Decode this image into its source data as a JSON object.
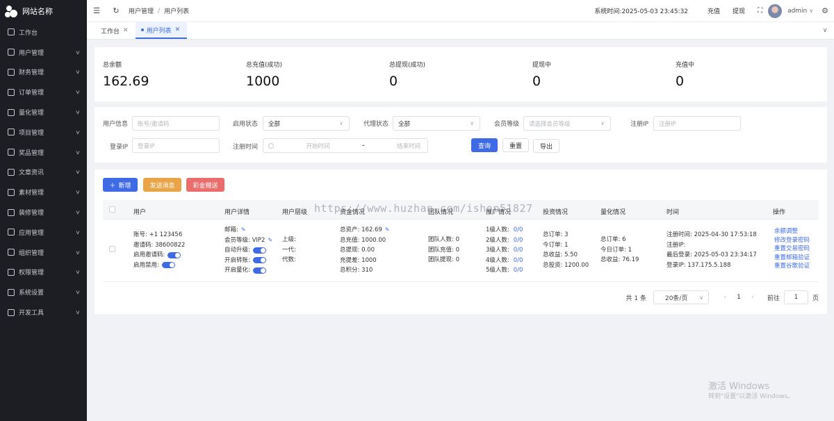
{
  "site": {
    "name": "网站名称"
  },
  "sidebar": {
    "items": [
      {
        "label": "工作台",
        "icon": "monitor-icon",
        "has_arrow": false
      },
      {
        "label": "用户管理",
        "icon": "user-icon",
        "has_arrow": true
      },
      {
        "label": "财务管理",
        "icon": "chart-icon",
        "has_arrow": true
      },
      {
        "label": "订单管理",
        "icon": "order-icon",
        "has_arrow": true
      },
      {
        "label": "量化管理",
        "icon": "quant-icon",
        "has_arrow": true
      },
      {
        "label": "项目管理",
        "icon": "project-icon",
        "has_arrow": true
      },
      {
        "label": "奖品管理",
        "icon": "gift-icon",
        "has_arrow": true
      },
      {
        "label": "文章资讯",
        "icon": "article-icon",
        "has_arrow": true
      },
      {
        "label": "素材管理",
        "icon": "image-icon",
        "has_arrow": true
      },
      {
        "label": "装修管理",
        "icon": "brush-icon",
        "has_arrow": true
      },
      {
        "label": "应用管理",
        "icon": "app-icon",
        "has_arrow": true
      },
      {
        "label": "组织管理",
        "icon": "org-icon",
        "has_arrow": true
      },
      {
        "label": "权限管理",
        "icon": "lock-icon",
        "has_arrow": true
      },
      {
        "label": "系统设置",
        "icon": "gear-icon",
        "has_arrow": true
      },
      {
        "label": "开发工具",
        "icon": "tool-icon",
        "has_arrow": true
      }
    ]
  },
  "header": {
    "breadcrumb": [
      "用户管理",
      "用户列表"
    ],
    "breadcrumb_sep": "/",
    "system_time_label": "系统时间:",
    "system_time": "2025-05-03 23:45:32",
    "recharge": "充值",
    "withdraw": "提现",
    "username": "admin"
  },
  "tabs": [
    {
      "label": "工作台",
      "active": false
    },
    {
      "label": "用户列表",
      "active": true
    }
  ],
  "stats": [
    {
      "label": "总余额",
      "value": "162.69"
    },
    {
      "label": "总充值(成功)",
      "value": "1000"
    },
    {
      "label": "总提现(成功)",
      "value": "0"
    },
    {
      "label": "提现中",
      "value": "0"
    },
    {
      "label": "充值中",
      "value": "0"
    }
  ],
  "filters": {
    "user_info_label": "用户信息",
    "user_info_placeholder": "账号/邀请码",
    "status_label": "启用状态",
    "status_value": "全部",
    "agent_label": "代理状态",
    "agent_value": "全部",
    "level_label": "会员等级",
    "level_placeholder": "请选择会员等级",
    "reg_ip_label": "注册IP",
    "reg_ip_placeholder": "注册IP",
    "login_ip_label": "登录IP",
    "login_ip_placeholder": "登录IP",
    "reg_time_label": "注册时间",
    "start_placeholder": "开始时间",
    "end_placeholder": "结束时间",
    "range_sep": "-",
    "search_btn": "查询",
    "reset_btn": "重置",
    "export_btn": "导出"
  },
  "toolbar": {
    "add": "新增",
    "send_message": "发送消息",
    "lottery": "彩金赠送"
  },
  "colors": {
    "primary": "#3f6ae6",
    "add": "#3f6ae6",
    "send": "#e8a446",
    "lottery": "#ea6c6c",
    "sidebar_bg": "#1d1e23"
  },
  "table": {
    "headers": [
      "用户",
      "用户详情",
      "用户层级",
      "资金情况",
      "团队情况",
      "推广情况",
      "投资情况",
      "量化情况",
      "时间",
      "操作"
    ],
    "row": {
      "user": [
        "账号: +1 123456",
        "邀请码: 38600822",
        "启用邀请码:",
        "启用禁用:"
      ],
      "detail": [
        "邮箱:",
        "会员等级: VIP2",
        "自动升级:",
        "开启转账:",
        "开启量化:"
      ],
      "level": [
        "上级:",
        "一代:",
        "代数:"
      ],
      "funds": [
        "总资产: 162.69",
        "总充值: 1000.00",
        "总提现: 0.00",
        "充提差: 1000",
        "总积分: 310"
      ],
      "team": [
        "团队人数: 0",
        "团队充值: 0",
        "团队提现: 0"
      ],
      "promo": [
        {
          "label": "1级人数:",
          "value": "0/0"
        },
        {
          "label": "2级人数:",
          "value": "0/0"
        },
        {
          "label": "3级人数:",
          "value": "0/0"
        },
        {
          "label": "4级人数:",
          "value": "0/0"
        },
        {
          "label": "5级人数:",
          "value": "0/0"
        }
      ],
      "invest": [
        "总订单: 3",
        "今订单: 1",
        "总收益: 5.50",
        "总投资: 1200.00"
      ],
      "quant": [
        "总订单: 6",
        "今日订单: 1",
        "总收益: 76.19"
      ],
      "time": [
        "注册时间: 2025-04-30 17:53:18",
        "注册IP:",
        "最后登录: 2025-05-03 23:34:17",
        "登录IP: 137.175.5.188"
      ],
      "actions": [
        "余额调整",
        "修改登录密码",
        "重置交易密码",
        "重置邮箱验证",
        "重置谷歌验证"
      ]
    }
  },
  "pagination": {
    "total": "共 1 条",
    "page_size": "20条/页",
    "current": "1",
    "goto_label": "前往",
    "goto_value": "1",
    "page_unit": "页"
  },
  "watermark": "https://www.huzhan.com/ishop51827",
  "windows_activation": {
    "title": "激活 Windows",
    "subtitle": "转到\"设置\"以激活 Windows。"
  }
}
